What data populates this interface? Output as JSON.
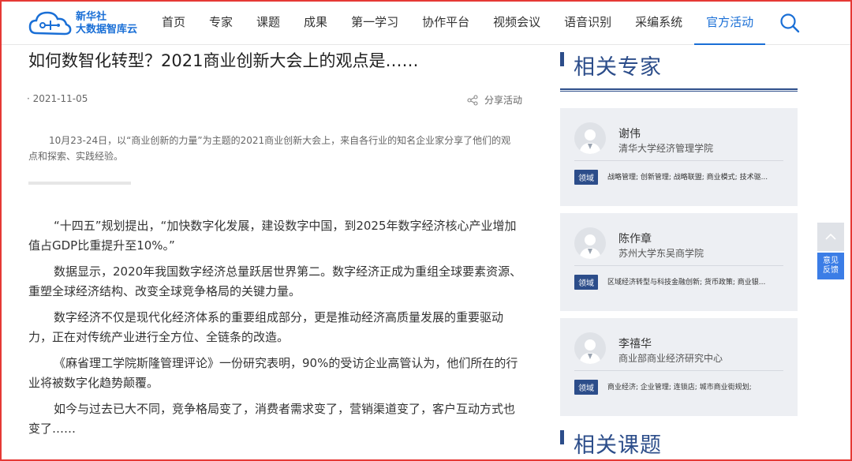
{
  "logo": {
    "line1": "新华社",
    "line2": "大数据智库云"
  },
  "nav": [
    {
      "label": "首页"
    },
    {
      "label": "专家"
    },
    {
      "label": "课题"
    },
    {
      "label": "成果"
    },
    {
      "label": "第一学习"
    },
    {
      "label": "协作平台"
    },
    {
      "label": "视频会议"
    },
    {
      "label": "语音识别"
    },
    {
      "label": "采编系统"
    },
    {
      "label": "官方活动",
      "active": true
    }
  ],
  "article": {
    "title": "如何数智化转型？2021商业创新大会上的观点是……",
    "date": "· 2021-11-05",
    "share_label": "分享活动",
    "summary": "10月23-24日，以“商业创新的力量”为主题的2021商业创新大会上，来自各行业的知名企业家分享了他们的观点和探索、实践经验。",
    "paragraphs": [
      "“十四五”规划提出，“加快数字化发展，建设数字中国，到2025年数字经济核心产业增加值占GDP比重提升至10%。”",
      "数据显示，2020年我国数字经济总量跃居世界第二。数字经济正成为重组全球要素资源、重塑全球经济结构、改变全球竞争格局的关键力量。",
      "数字经济不仅是现代化经济体系的重要组成部分，更是推动经济高质量发展的重要驱动力，正在对传统产业进行全方位、全链条的改造。",
      "《麻省理工学院斯隆管理评论》一份研究表明，90%的受访企业高管认为，他们所在的行业将被数字化趋势颠覆。",
      "如今与过去已大不同，竞争格局变了，消费者需求变了，营销渠道变了，客户互动方式也变了……"
    ]
  },
  "sidebar": {
    "experts_title": "相关专家",
    "topics_title": "相关课题",
    "field_tag": "领域",
    "experts": [
      {
        "name": "谢伟",
        "org": "清华大学经济管理学院",
        "fields": "战略管理; 创新管理; 战略联盟; 商业模式; 技术驱..."
      },
      {
        "name": "陈作章",
        "org": "苏州大学东吴商学院",
        "fields": "区域经济转型与科技金融创新; 货币政策; 商业银..."
      },
      {
        "name": "李禧华",
        "org": "商业部商业经济研究中心",
        "fields": "商业经济; 企业管理; 连锁店; 城市商业街规划;"
      }
    ]
  },
  "floating": {
    "feedback_line1": "意见",
    "feedback_line2": "反馈"
  },
  "colors": {
    "primary": "#1a6fd6",
    "navy": "#2c4d8a",
    "card_bg": "#edeff3",
    "frame": "#e53935"
  }
}
